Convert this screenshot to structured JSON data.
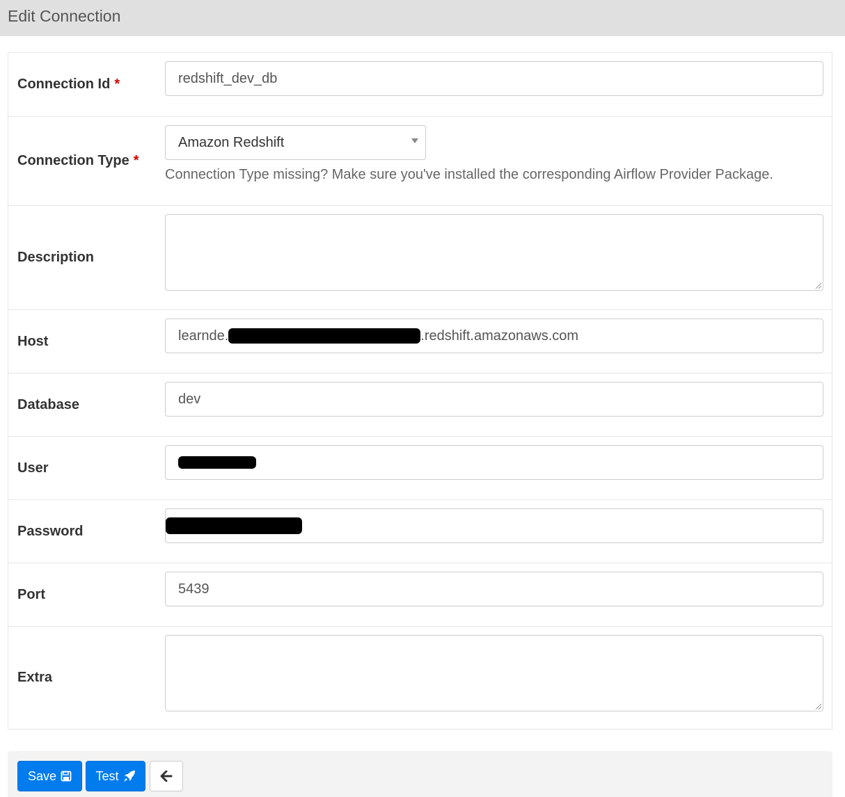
{
  "header": {
    "title": "Edit Connection"
  },
  "form": {
    "connection_id": {
      "label": "Connection Id",
      "required_mark": "*",
      "value": "redshift_dev_db"
    },
    "connection_type": {
      "label": "Connection Type",
      "required_mark": "*",
      "selected": "Amazon Redshift",
      "help_text": "Connection Type missing? Make sure you've installed the corresponding Airflow Provider Package."
    },
    "description": {
      "label": "Description",
      "value": ""
    },
    "host": {
      "label": "Host",
      "value_prefix": "learnde.",
      "value_suffix": ".redshift.amazonaws.com"
    },
    "database": {
      "label": "Database",
      "value": "dev"
    },
    "user": {
      "label": "User"
    },
    "password": {
      "label": "Password"
    },
    "port": {
      "label": "Port",
      "value": "5439"
    },
    "extra": {
      "label": "Extra",
      "value": ""
    }
  },
  "actions": {
    "save_label": "Save",
    "test_label": "Test",
    "save_icon": "floppy-disk-icon",
    "test_icon": "rocket-icon",
    "back_icon": "arrow-left-icon"
  },
  "colors": {
    "primary": "#017cee",
    "required": "#d60000",
    "header_bg": "#e0e0e0"
  }
}
